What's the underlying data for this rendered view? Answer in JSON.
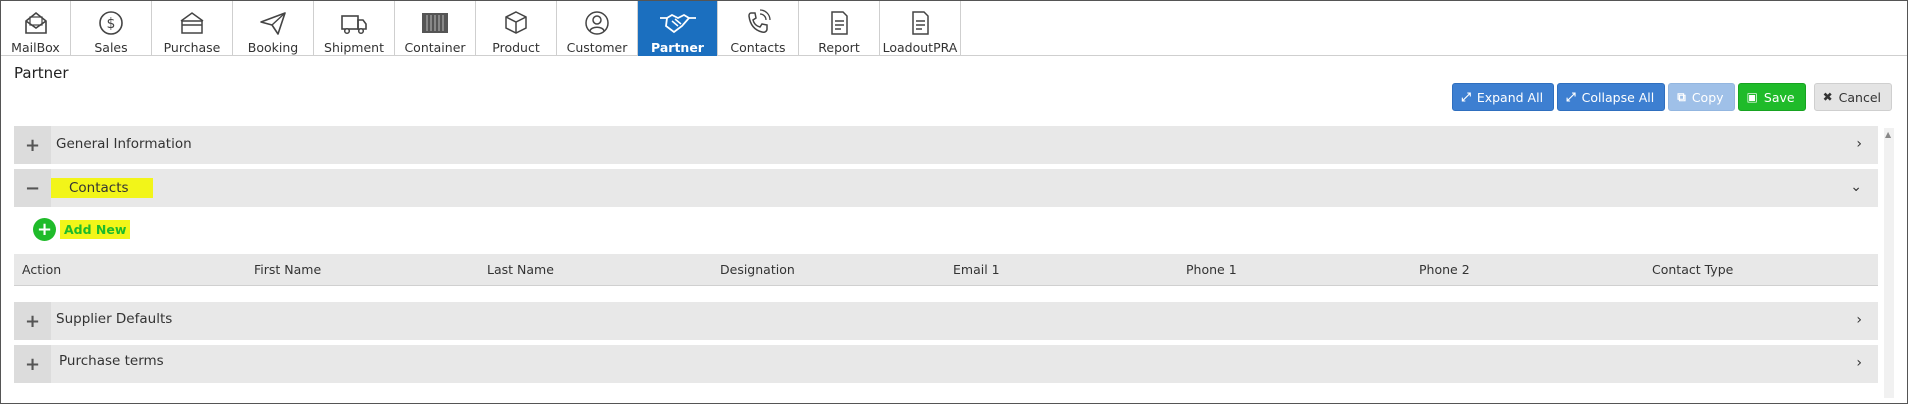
{
  "nav": {
    "items": [
      {
        "label": "MailBox",
        "icon": "mailbox-icon"
      },
      {
        "label": "Sales",
        "icon": "dollar-icon"
      },
      {
        "label": "Purchase",
        "icon": "card-icon"
      },
      {
        "label": "Booking",
        "icon": "paper-plane-icon"
      },
      {
        "label": "Shipment",
        "icon": "truck-icon"
      },
      {
        "label": "Container",
        "icon": "container-icon"
      },
      {
        "label": "Product",
        "icon": "box-icon"
      },
      {
        "label": "Customer",
        "icon": "user-icon"
      },
      {
        "label": "Partner",
        "icon": "handshake-icon"
      },
      {
        "label": "Contacts",
        "icon": "phone-icon"
      },
      {
        "label": "Report",
        "icon": "report-icon"
      },
      {
        "label": "LoadoutPRA",
        "icon": "document-icon"
      }
    ],
    "active": "Partner",
    "active_color": "#1b6fbf"
  },
  "page": {
    "title": "Partner"
  },
  "toolbar": {
    "expand_all": "Expand All",
    "collapse_all": "Collapse All",
    "copy": "Copy",
    "save": "Save",
    "cancel": "Cancel"
  },
  "sections": {
    "general": {
      "label": "General Information",
      "state": "collapsed"
    },
    "contacts": {
      "label": "Contacts",
      "state": "expanded"
    },
    "supplier": {
      "label": "Supplier Defaults",
      "state": "collapsed"
    },
    "purchase": {
      "label": "Purchase terms",
      "state": "collapsed"
    }
  },
  "contacts": {
    "add_new": "Add New",
    "columns": [
      "Action",
      "First Name",
      "Last Name",
      "Designation",
      "Email 1",
      "Phone 1",
      "Phone 2",
      "Contact Type"
    ]
  },
  "colors": {
    "primary": "#3d7fd1",
    "success": "#1fbb2a",
    "highlight": "#f2f519"
  }
}
